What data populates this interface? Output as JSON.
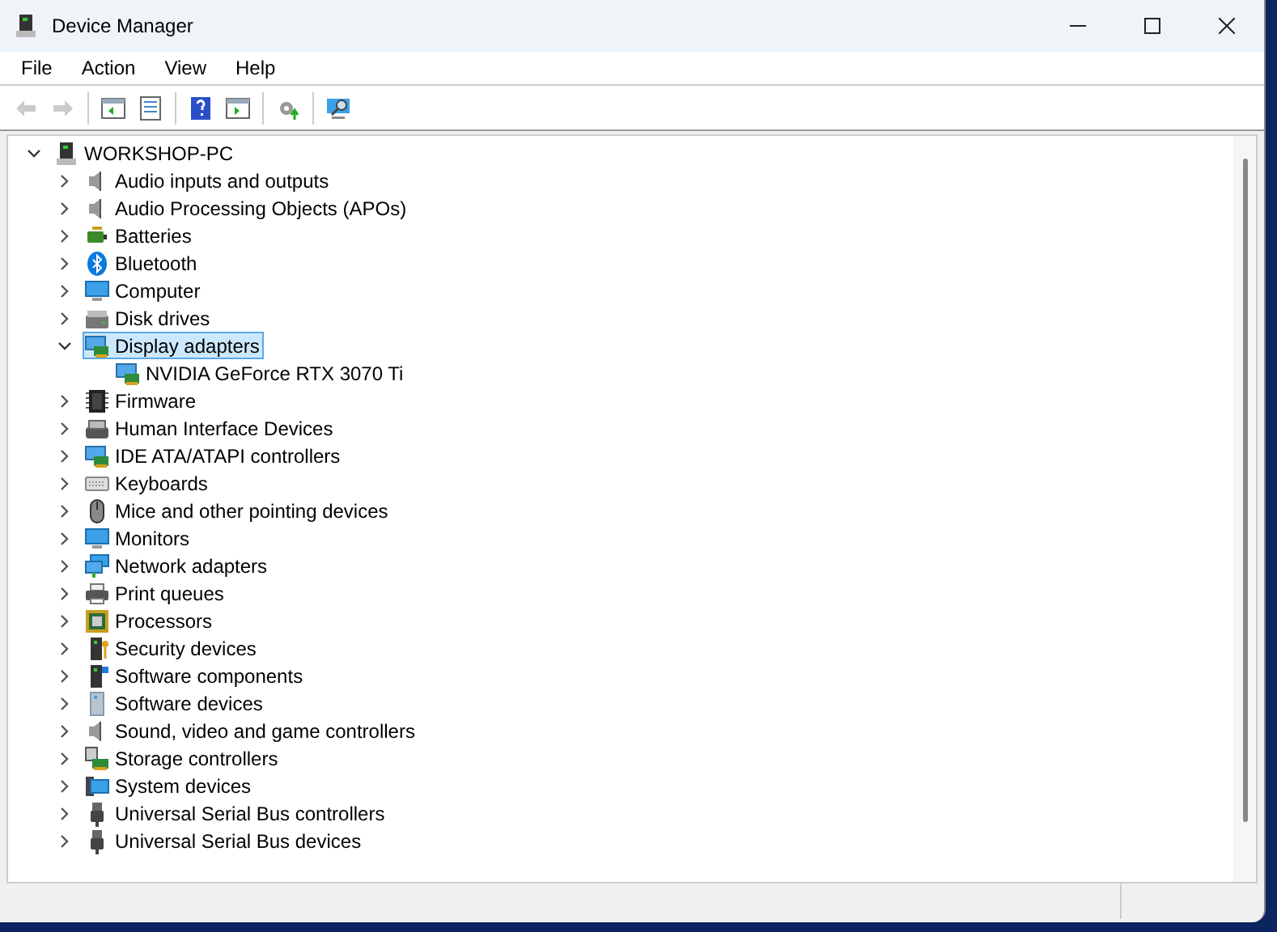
{
  "window": {
    "title": "Device Manager"
  },
  "menu": [
    "File",
    "Action",
    "View",
    "Help"
  ],
  "toolbar": [
    {
      "disabled": true
    },
    {
      "disabled": true
    },
    {
      "disabled": false
    },
    {
      "disabled": false
    },
    {
      "disabled": false
    },
    {
      "disabled": false
    },
    {
      "disabled": false
    },
    {
      "disabled": false
    }
  ],
  "tree": {
    "label": "WORKSHOP-PC",
    "expanded": true,
    "selected": false,
    "children": [
      {
        "label": "Audio inputs and outputs",
        "expanded": false,
        "selected": false
      },
      {
        "label": "Audio Processing Objects (APOs)",
        "expanded": false,
        "selected": false
      },
      {
        "label": "Batteries",
        "expanded": false,
        "selected": false
      },
      {
        "label": "Bluetooth",
        "expanded": false,
        "selected": false
      },
      {
        "label": "Computer",
        "expanded": false,
        "selected": false
      },
      {
        "label": "Disk drives",
        "expanded": false,
        "selected": false
      },
      {
        "label": "Display adapters",
        "expanded": true,
        "selected": true,
        "children": [
          {
            "label": "NVIDIA GeForce RTX 3070 Ti",
            "selected": false
          }
        ]
      },
      {
        "label": "Firmware",
        "expanded": false,
        "selected": false
      },
      {
        "label": "Human Interface Devices",
        "expanded": false,
        "selected": false
      },
      {
        "label": "IDE ATA/ATAPI controllers",
        "expanded": false,
        "selected": false
      },
      {
        "label": "Keyboards",
        "expanded": false,
        "selected": false
      },
      {
        "label": "Mice and other pointing devices",
        "expanded": false,
        "selected": false
      },
      {
        "label": "Monitors",
        "expanded": false,
        "selected": false
      },
      {
        "label": "Network adapters",
        "expanded": false,
        "selected": false
      },
      {
        "label": "Print queues",
        "expanded": false,
        "selected": false
      },
      {
        "label": "Processors",
        "expanded": false,
        "selected": false
      },
      {
        "label": "Security devices",
        "expanded": false,
        "selected": false
      },
      {
        "label": "Software components",
        "expanded": false,
        "selected": false
      },
      {
        "label": "Software devices",
        "expanded": false,
        "selected": false
      },
      {
        "label": "Sound, video and game controllers",
        "expanded": false,
        "selected": false
      },
      {
        "label": "Storage controllers",
        "expanded": false,
        "selected": false
      },
      {
        "label": "System devices",
        "expanded": false,
        "selected": false
      },
      {
        "label": "Universal Serial Bus controllers",
        "expanded": false,
        "selected": false
      },
      {
        "label": "Universal Serial Bus devices",
        "expanded": false,
        "selected": false
      }
    ]
  }
}
